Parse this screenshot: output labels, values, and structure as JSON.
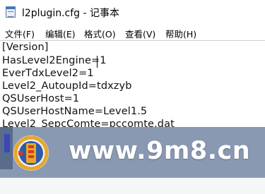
{
  "window": {
    "title": "l2plugin.cfg - 记事本",
    "icon": "notepad-icon"
  },
  "menu": {
    "items": [
      {
        "label": "文件(F)"
      },
      {
        "label": "编辑(E)"
      },
      {
        "label": "格式(O)"
      },
      {
        "label": "查看(V)"
      },
      {
        "label": "帮助(H)"
      }
    ]
  },
  "editor": {
    "lines": [
      "[Version]",
      "HasLevel2Engine=1",
      "EverTdxLevel2=1",
      "Level2_AutoupId=tdxzyb",
      "QSUserHost=1",
      "QSUserHostName=Level1.5",
      "Level2_SepcComte=pccomte.dat"
    ]
  },
  "watermark": {
    "url_text": "www.9m8.cn",
    "logo": "seal-logo-icon",
    "colors": {
      "banner": "#8a99b2",
      "seal_gold": "#e8a72a",
      "seal_blue": "#2e5ba8",
      "seal_red": "#d33a2a"
    }
  }
}
